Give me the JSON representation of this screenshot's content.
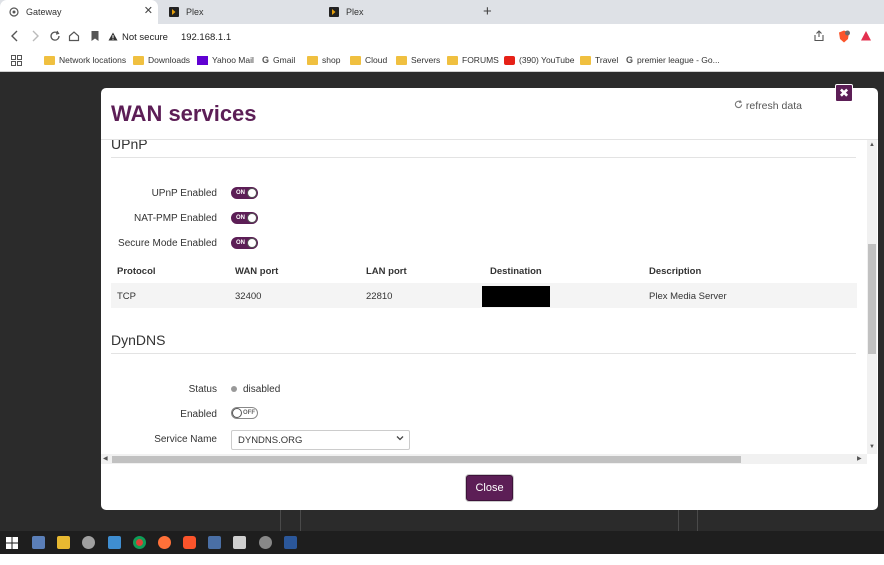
{
  "browser": {
    "tabs": [
      {
        "title": "Gateway",
        "active": true
      },
      {
        "title": "Plex",
        "active": false
      },
      {
        "title": "Plex",
        "active": false
      }
    ],
    "new_tab_glyph": "+",
    "close_glyph": "✕",
    "security_label": "Not secure",
    "url": "192.168.1.1",
    "bookmarks": [
      {
        "label": "Network locations",
        "icon": "folder-icon"
      },
      {
        "label": "Downloads",
        "icon": "folder-icon"
      },
      {
        "label": "Yahoo Mail",
        "icon": "yahoo-icon"
      },
      {
        "label": "Gmail",
        "icon": "google-icon"
      },
      {
        "label": "shop",
        "icon": "folder-icon"
      },
      {
        "label": "Cloud",
        "icon": "folder-icon"
      },
      {
        "label": "Servers",
        "icon": "folder-icon"
      },
      {
        "label": "FORUMS",
        "icon": "folder-icon"
      },
      {
        "label": "(390) YouTube",
        "icon": "youtube-icon"
      },
      {
        "label": "Travel",
        "icon": "folder-icon"
      },
      {
        "label": "premier league - Go...",
        "icon": "google-icon"
      }
    ]
  },
  "modal": {
    "title": "WAN services",
    "refresh_label": "refresh data",
    "close_glyph": "✖",
    "upnp": {
      "section_title": "UPnP",
      "fields": [
        {
          "label": "UPnP Enabled",
          "state": "ON"
        },
        {
          "label": "NAT-PMP Enabled",
          "state": "ON"
        },
        {
          "label": "Secure Mode Enabled",
          "state": "ON"
        }
      ],
      "table": {
        "headers": [
          "Protocol",
          "WAN port",
          "LAN port",
          "Destination",
          "Description"
        ],
        "rows": [
          {
            "protocol": "TCP",
            "wan_port": "32400",
            "lan_port": "22810",
            "destination": "",
            "description": "Plex Media Server"
          }
        ]
      }
    },
    "dyndns": {
      "section_title": "DynDNS",
      "status_label": "Status",
      "status_value": "disabled",
      "enabled_label": "Enabled",
      "enabled_state": "OFF",
      "service_name_label": "Service Name",
      "service_name_value": "DYNDNS.ORG"
    },
    "close_button_label": "Close"
  },
  "colors": {
    "brand": "#5c1e56",
    "backdrop": "#2b2b2b"
  }
}
